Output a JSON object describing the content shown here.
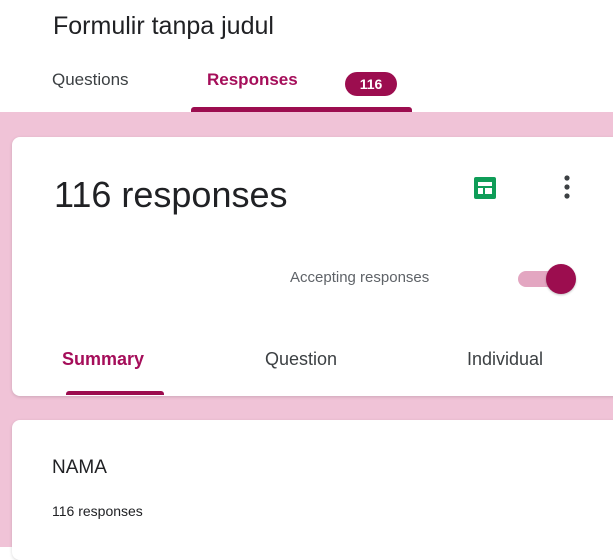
{
  "form": {
    "title": "Formulir tanpa judul"
  },
  "tabs": [
    {
      "label": "Questions",
      "active": false
    },
    {
      "label": "Responses",
      "active": true,
      "badge": "116"
    }
  ],
  "summary": {
    "heading": "116 responses",
    "sheets_icon": "google-sheets-icon",
    "more_icon": "more-vert-icon",
    "accepting_label": "Accepting responses",
    "accepting": true,
    "subtabs": [
      {
        "label": "Summary",
        "active": true
      },
      {
        "label": "Question",
        "active": false
      },
      {
        "label": "Individual",
        "active": false
      }
    ]
  },
  "question_card": {
    "title": "NAMA",
    "count": "116 responses"
  },
  "colors": {
    "accent": "#9c0d4f",
    "accent_text": "#a50e5a",
    "background": "#f0c3d7",
    "sheets_green": "#0f9d58"
  }
}
